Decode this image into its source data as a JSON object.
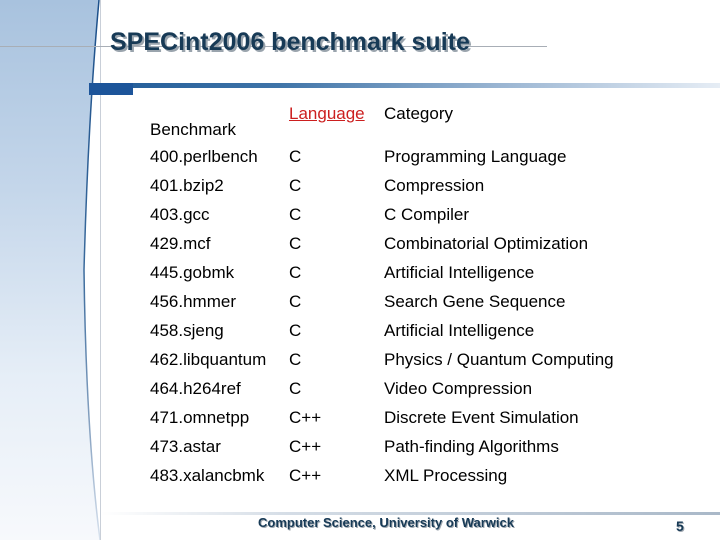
{
  "slide": {
    "title": "SPECint2006 benchmark suite",
    "footer": "Computer Science, University of Warwick",
    "page_number": "5",
    "colors": {
      "title": "#173a56",
      "accent_blue": "#1d559a",
      "link_red": "#cc1f1f"
    }
  },
  "table": {
    "headers": {
      "benchmark": "Benchmark",
      "language": "Language",
      "category": "Category"
    },
    "rows": [
      {
        "benchmark": "400.perlbench",
        "language": "C",
        "category": "Programming Language"
      },
      {
        "benchmark": "401.bzip2",
        "language": "C",
        "category": "Compression"
      },
      {
        "benchmark": "403.gcc",
        "language": "C",
        "category": "C Compiler"
      },
      {
        "benchmark": "429.mcf",
        "language": "C",
        "category": "Combinatorial Optimization"
      },
      {
        "benchmark": "445.gobmk",
        "language": "C",
        "category": "Artificial Intelligence"
      },
      {
        "benchmark": "456.hmmer",
        "language": "C",
        "category": "Search Gene Sequence"
      },
      {
        "benchmark": "458.sjeng",
        "language": "C",
        "category": "Artificial Intelligence"
      },
      {
        "benchmark": "462.libquantum",
        "language": "C",
        "category": "Physics / Quantum Computing"
      },
      {
        "benchmark": "464.h264ref",
        "language": "C",
        "category": "Video Compression"
      },
      {
        "benchmark": "471.omnetpp",
        "language": "C++",
        "category": "Discrete Event Simulation"
      },
      {
        "benchmark": "473.astar",
        "language": "C++",
        "category": "Path-finding Algorithms"
      },
      {
        "benchmark": "483.xalancbmk",
        "language": "C++",
        "category": "XML Processing"
      }
    ]
  }
}
